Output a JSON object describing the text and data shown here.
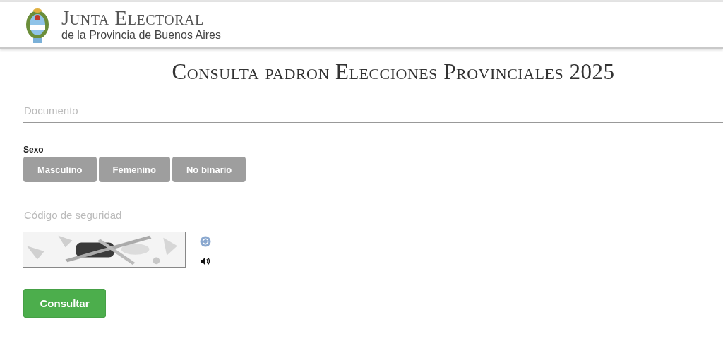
{
  "header": {
    "title": "Junta Electoral",
    "subtitle": "de la Provincia de Buenos Aires"
  },
  "page_title": "Consulta padron Elecciones Provinciales 2025",
  "document_field": {
    "placeholder": "Documento"
  },
  "sex": {
    "label": "Sexo",
    "options": [
      {
        "label": "Masculino",
        "selected": false
      },
      {
        "label": "Femenino",
        "selected": false
      },
      {
        "label": "No binario",
        "selected": false
      }
    ]
  },
  "security_code_field": {
    "placeholder": "Código de seguridad"
  },
  "submit_button": "Consultar"
}
